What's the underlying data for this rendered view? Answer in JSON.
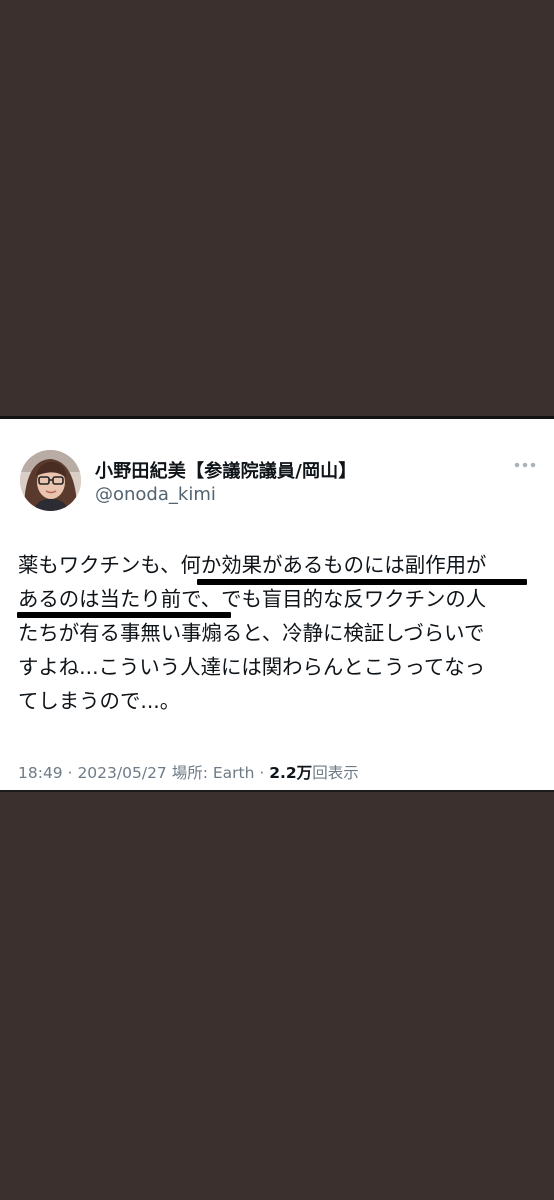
{
  "tweet": {
    "display_name": "小野田紀美【参議院議員/岡山】",
    "handle": "@onoda_kimi",
    "more_icon": "more-horizontal-icon",
    "body_lines": [
      "薬もワクチンも、何か効果があるものには副作用が",
      "あるのは当たり前で、でも盲目的な反ワクチンの人",
      "たちが有る事無い事煽ると、冷静に検証しづらいで",
      "すよね...こういう人達には関わらんとこうってなっ",
      "てしまうので...。"
    ],
    "highlighted_phrase": "何か効果があるものには副作用があるのは当たり前で",
    "meta": {
      "time_date_location": "18:49 · 2023/05/27 場所: Earth · ",
      "views_count": "2.2万",
      "views_label": "回表示"
    }
  },
  "colors": {
    "background": "#3b302d",
    "card": "#ffffff",
    "text_primary": "#0f1419",
    "text_secondary": "#536471",
    "underline": "#000000"
  }
}
